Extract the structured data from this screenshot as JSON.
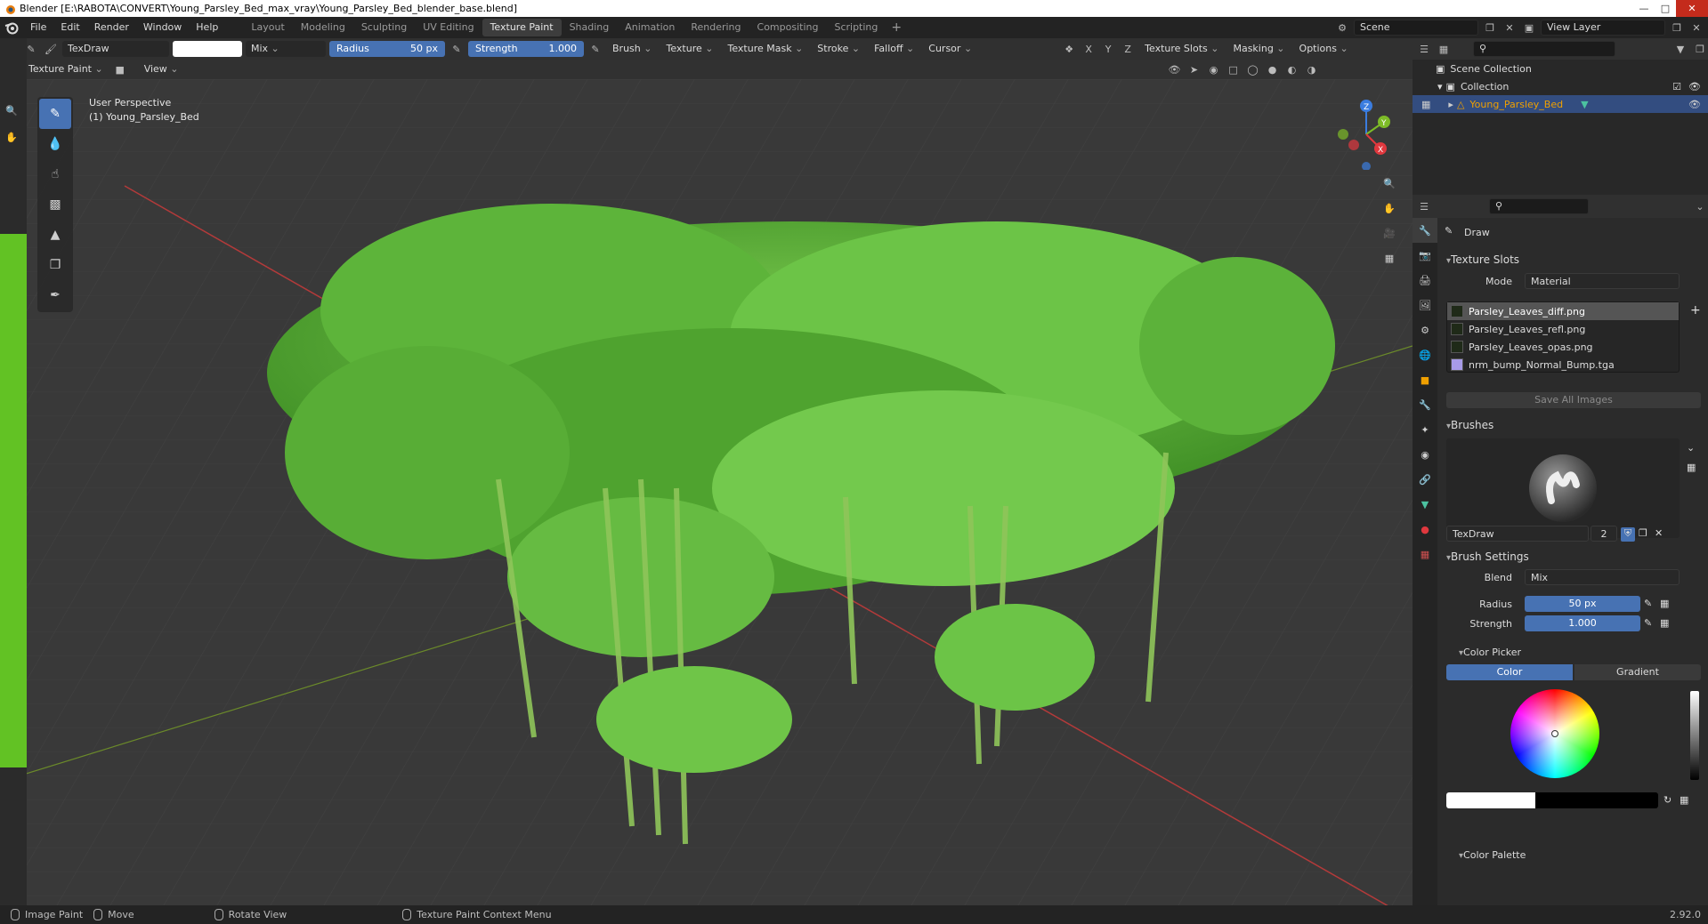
{
  "window": {
    "title": "Blender [E:\\RABOTA\\CONVERT\\Young_Parsley_Bed_max_vray\\Young_Parsley_Bed_blender_base.blend]",
    "minimize": "—",
    "maximize": "□",
    "close": "✕"
  },
  "menu": {
    "file": "File",
    "edit": "Edit",
    "render": "Render",
    "window": "Window",
    "help": "Help"
  },
  "workspaces": [
    {
      "label": "Layout"
    },
    {
      "label": "Modeling"
    },
    {
      "label": "Sculpting"
    },
    {
      "label": "UV Editing"
    },
    {
      "label": "Texture Paint"
    },
    {
      "label": "Shading"
    },
    {
      "label": "Animation"
    },
    {
      "label": "Rendering"
    },
    {
      "label": "Compositing"
    },
    {
      "label": "Scripting"
    }
  ],
  "active_workspace": "Texture Paint",
  "scene": {
    "name": "Scene",
    "view_layer": "View Layer"
  },
  "tool_header": {
    "brush_name": "TexDraw",
    "blend": "Mix",
    "radius_label": "Radius",
    "radius_value": "50 px",
    "strength_label": "Strength",
    "strength_value": "1.000",
    "menus": [
      "Brush",
      "Texture",
      "Texture Mask",
      "Stroke",
      "Falloff",
      "Cursor"
    ],
    "axes": [
      "X",
      "Y",
      "Z"
    ],
    "right_menus": [
      "Texture Slots",
      "Masking",
      "Options"
    ]
  },
  "viewport_header": {
    "mode": "Texture Paint",
    "view": "View"
  },
  "viewport": {
    "perspective": "User Perspective",
    "object": "(1) Young_Parsley_Bed",
    "gizmo": {
      "z": "Z",
      "y": "Y",
      "x": "X"
    }
  },
  "outliner": {
    "scene_collection": "Scene Collection",
    "collection": "Collection",
    "object": "Young_Parsley_Bed"
  },
  "properties": {
    "tool_title": "Draw",
    "texture_slots": {
      "header": "Texture Slots",
      "mode_label": "Mode",
      "mode_value": "Material",
      "slots": [
        {
          "name": "Parsley_Leaves_diff.png"
        },
        {
          "name": "Parsley_Leaves_refl.png"
        },
        {
          "name": "Parsley_Leaves_opas.png"
        },
        {
          "name": "nrm_bump_Normal_Bump.tga"
        }
      ],
      "save_all": "Save All Images"
    },
    "brushes": {
      "header": "Brushes",
      "name": "TexDraw",
      "users": "2"
    },
    "brush_settings": {
      "header": "Brush Settings",
      "blend_label": "Blend",
      "blend_value": "Mix",
      "radius_label": "Radius",
      "radius_value": "50 px",
      "strength_label": "Strength",
      "strength_value": "1.000",
      "color_picker": "Color Picker",
      "tab_color": "Color",
      "tab_gradient": "Gradient",
      "color_palette": "Color Palette"
    }
  },
  "statusbar": {
    "left": "Image Paint",
    "middle1": "Move",
    "middle2": "Rotate View",
    "context": "Texture Paint Context Menu",
    "version": "2.92.0"
  },
  "colors": {
    "accent": "#4772b3",
    "selected_row": "#334d80",
    "object_orange": "#f0a000"
  }
}
